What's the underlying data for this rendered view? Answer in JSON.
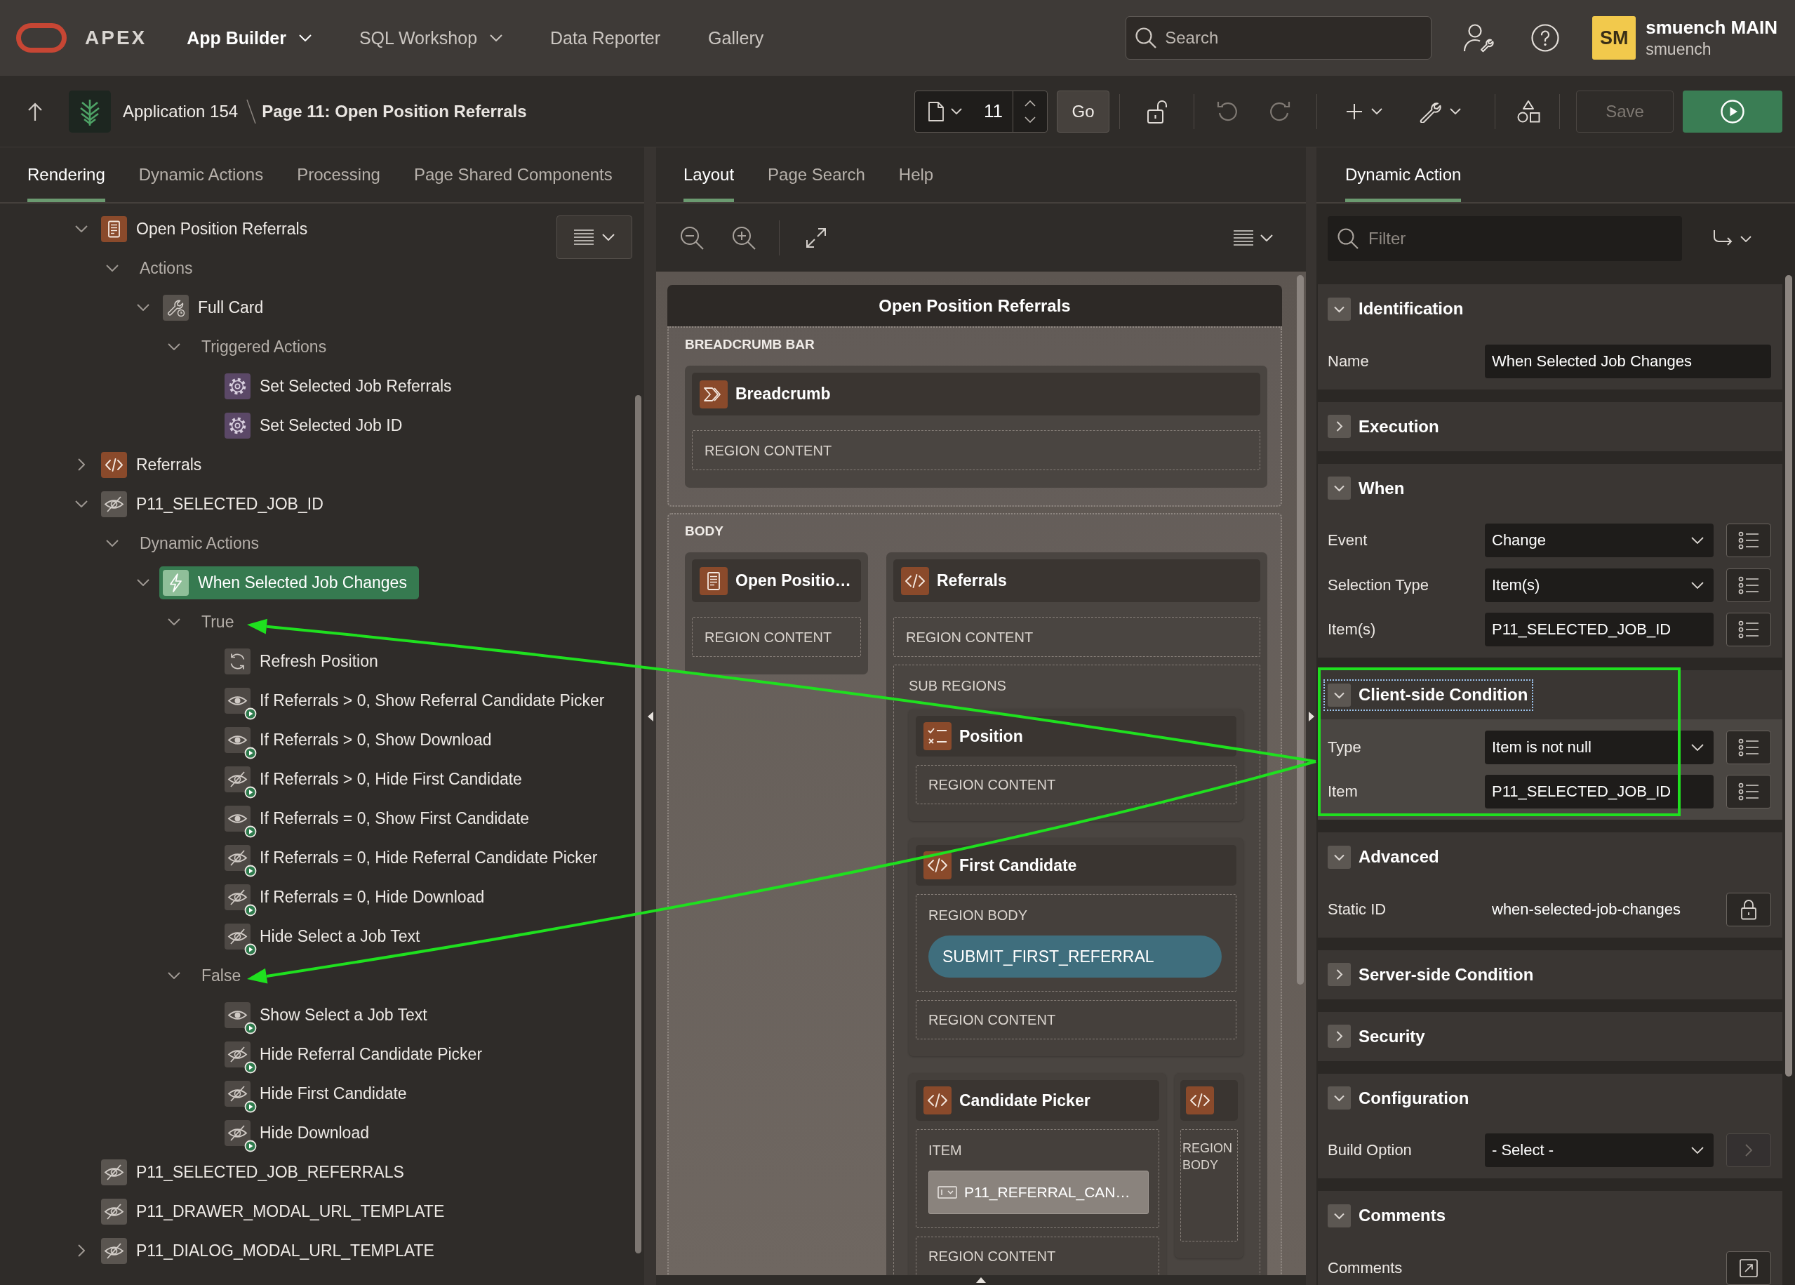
{
  "top_nav": {
    "product": "APEX",
    "menus": [
      {
        "label": "App Builder",
        "kind": "menu",
        "selected": true
      },
      {
        "label": "SQL Workshop",
        "kind": "menu",
        "selected": false
      },
      {
        "label": "Data Reporter",
        "kind": "link",
        "selected": false
      },
      {
        "label": "Gallery",
        "kind": "link",
        "selected": false
      }
    ],
    "search": {
      "placeholder": "Search"
    },
    "user": {
      "initials": "SM",
      "name": "smuench MAIN",
      "workspace": "smuench"
    }
  },
  "page_bar": {
    "application": "Application 154",
    "page": "Page 11: Open Position Referrals",
    "page_number": "11",
    "go": "Go",
    "undo": {
      "disabled": true
    },
    "redo": {
      "disabled": true
    },
    "save": {
      "label": "Save",
      "disabled": true
    }
  },
  "rendering_panel": {
    "tabs": [
      {
        "label": "Rendering",
        "selected": true
      },
      {
        "label": "Dynamic Actions",
        "selected": false
      },
      {
        "label": "Processing",
        "selected": false
      },
      {
        "label": "Page Shared Components",
        "selected": false
      }
    ],
    "tree": [
      {
        "label": "Open Position Referrals",
        "kind": "cards",
        "expanded": true,
        "selected": false,
        "children": [
          {
            "label": "Actions",
            "kind": "folder",
            "expanded": true,
            "selected": false,
            "children": [
              {
                "label": "Full Card",
                "kind": "card-action",
                "expanded": true,
                "selected": false,
                "children": [
                  {
                    "label": "Triggered Actions",
                    "kind": "folder",
                    "expanded": true,
                    "selected": false,
                    "children": [
                      {
                        "label": "Set Selected Job Referrals",
                        "kind": "set-value",
                        "selected": false
                      },
                      {
                        "label": "Set Selected Job ID",
                        "kind": "set-value",
                        "selected": false
                      }
                    ]
                  }
                ]
              }
            ]
          }
        ]
      },
      {
        "label": "Referrals",
        "kind": "static-content",
        "expanded": false,
        "selected": false
      },
      {
        "label": "P11_SELECTED_JOB_ID",
        "kind": "hidden-item",
        "expanded": true,
        "selected": false,
        "children": [
          {
            "label": "Dynamic Actions",
            "kind": "folder",
            "expanded": true,
            "selected": false,
            "children": [
              {
                "label": "When Selected Job Changes",
                "kind": "dynamic-action",
                "expanded": true,
                "selected": true,
                "children": [
                  {
                    "label": "True",
                    "kind": "folder",
                    "expanded": true,
                    "selected": false,
                    "children": [
                      {
                        "label": "Refresh Position",
                        "kind": "refresh",
                        "selected": false
                      },
                      {
                        "label": "If Referrals > 0, Show Referral Candidate Picker",
                        "kind": "show",
                        "selected": false
                      },
                      {
                        "label": "If Referrals > 0, Show Download",
                        "kind": "show",
                        "selected": false
                      },
                      {
                        "label": "If Referrals > 0, Hide First Candidate",
                        "kind": "hide",
                        "selected": false
                      },
                      {
                        "label": "If Referrals = 0, Show First Candidate",
                        "kind": "show",
                        "selected": false
                      },
                      {
                        "label": "If Referrals = 0, Hide Referral Candidate Picker",
                        "kind": "hide",
                        "selected": false
                      },
                      {
                        "label": "If Referrals = 0, Hide Download",
                        "kind": "hide",
                        "selected": false
                      },
                      {
                        "label": "Hide Select a Job Text",
                        "kind": "hide",
                        "selected": false
                      }
                    ]
                  },
                  {
                    "label": "False",
                    "kind": "folder",
                    "expanded": true,
                    "selected": false,
                    "children": [
                      {
                        "label": "Show Select a Job Text",
                        "kind": "show",
                        "selected": false
                      },
                      {
                        "label": "Hide Referral Candidate Picker",
                        "kind": "hide",
                        "selected": false
                      },
                      {
                        "label": "Hide First Candidate",
                        "kind": "hide",
                        "selected": false
                      },
                      {
                        "label": "Hide Download",
                        "kind": "hide",
                        "selected": false
                      }
                    ]
                  }
                ]
              }
            ]
          }
        ]
      },
      {
        "label": "P11_SELECTED_JOB_REFERRALS",
        "kind": "hidden-item",
        "selected": false
      },
      {
        "label": "P11_DRAWER_MODAL_URL_TEMPLATE",
        "kind": "hidden-item",
        "selected": false
      },
      {
        "label": "P11_DIALOG_MODAL_URL_TEMPLATE",
        "kind": "hidden-item",
        "expanded": false,
        "selected": false
      }
    ]
  },
  "layout_panel": {
    "tabs": [
      {
        "label": "Layout",
        "selected": true
      },
      {
        "label": "Page Search",
        "selected": false
      },
      {
        "label": "Help",
        "selected": false
      }
    ],
    "page_title": "Open Position Referrals",
    "positions": [
      {
        "label": "BREADCRUMB BAR",
        "rows": [
          [
            {
              "kind": "breadcrumb",
              "title": "Breadcrumb",
              "slots": [
                {
                  "label": "REGION CONTENT"
                }
              ]
            }
          ]
        ]
      },
      {
        "label": "BODY",
        "rows": [
          [
            {
              "kind": "cards",
              "title": "Open Positio…",
              "slots": [
                {
                  "label": "REGION CONTENT"
                }
              ]
            },
            {
              "kind": "static-content",
              "title": "Referrals",
              "slots": [
                {
                  "label": "REGION CONTENT"
                },
                {
                  "label": "SUB REGIONS",
                  "rows": [
                    [
                      {
                        "kind": "checklist",
                        "title": "Position",
                        "slots": [
                          {
                            "label": "REGION CONTENT"
                          }
                        ]
                      }
                    ],
                    [
                      {
                        "kind": "static-content",
                        "title": "First Candidate",
                        "slots": [
                          {
                            "label": "REGION BODY",
                            "buttons": [
                              "SUBMIT_FIRST_REFERRAL"
                            ]
                          },
                          {
                            "label": "REGION CONTENT"
                          }
                        ]
                      }
                    ],
                    [
                      {
                        "kind": "static-content",
                        "title": "Candidate Picker",
                        "slots": [
                          {
                            "label": "ITEM",
                            "items": [
                              "P11_REFERRAL_CAN…"
                            ]
                          },
                          {
                            "label": "REGION CONTENT"
                          }
                        ]
                      },
                      {
                        "kind": "static-content",
                        "slots": [
                          {
                            "label": "REGION BODY"
                          }
                        ]
                      }
                    ]
                  ]
                }
              ]
            }
          ]
        ]
      }
    ]
  },
  "property_panel": {
    "tabs": [
      {
        "label": "Dynamic Action",
        "selected": true
      }
    ],
    "filter": {
      "placeholder": "Filter"
    },
    "groups": [
      {
        "title": "Identification",
        "expanded": true,
        "focused": false,
        "rows": [
          {
            "label": "Name",
            "kind": "text",
            "value": "When Selected Job Changes"
          }
        ]
      },
      {
        "title": "Execution",
        "expanded": false,
        "focused": false
      },
      {
        "title": "When",
        "expanded": true,
        "focused": false,
        "rows": [
          {
            "label": "Event",
            "kind": "select",
            "value": "Change",
            "button": {
              "kind": "list",
              "disabled": false
            }
          },
          {
            "label": "Selection Type",
            "kind": "select",
            "value": "Item(s)",
            "button": {
              "kind": "list",
              "disabled": false
            }
          },
          {
            "label": "Item(s)",
            "kind": "text",
            "value": "P11_SELECTED_JOB_ID",
            "button": {
              "kind": "list",
              "disabled": false
            }
          }
        ]
      },
      {
        "title": "Client-side Condition",
        "expanded": true,
        "focused": true,
        "rows": [
          {
            "label": "Type",
            "kind": "select",
            "value": "Item is not null",
            "button": {
              "kind": "list",
              "disabled": false
            }
          },
          {
            "label": "Item",
            "kind": "text",
            "value": "P11_SELECTED_JOB_ID",
            "button": {
              "kind": "list",
              "disabled": false
            }
          }
        ]
      },
      {
        "title": "Advanced",
        "expanded": true,
        "focused": false,
        "rows": [
          {
            "label": "Static ID",
            "kind": "static",
            "value": "when-selected-job-changes",
            "button": {
              "kind": "lock",
              "disabled": false
            }
          }
        ]
      },
      {
        "title": "Server-side Condition",
        "expanded": false,
        "focused": false
      },
      {
        "title": "Security",
        "expanded": false,
        "focused": false
      },
      {
        "title": "Configuration",
        "expanded": true,
        "focused": false,
        "rows": [
          {
            "label": "Build Option",
            "kind": "select",
            "value": "- Select -",
            "button": {
              "kind": "next",
              "disabled": true
            }
          }
        ]
      },
      {
        "title": "Comments",
        "expanded": true,
        "focused": false,
        "rows": [
          {
            "label": "Comments",
            "kind": "textarea",
            "button": {
              "kind": "expand",
              "disabled": false
            }
          }
        ]
      }
    ]
  }
}
